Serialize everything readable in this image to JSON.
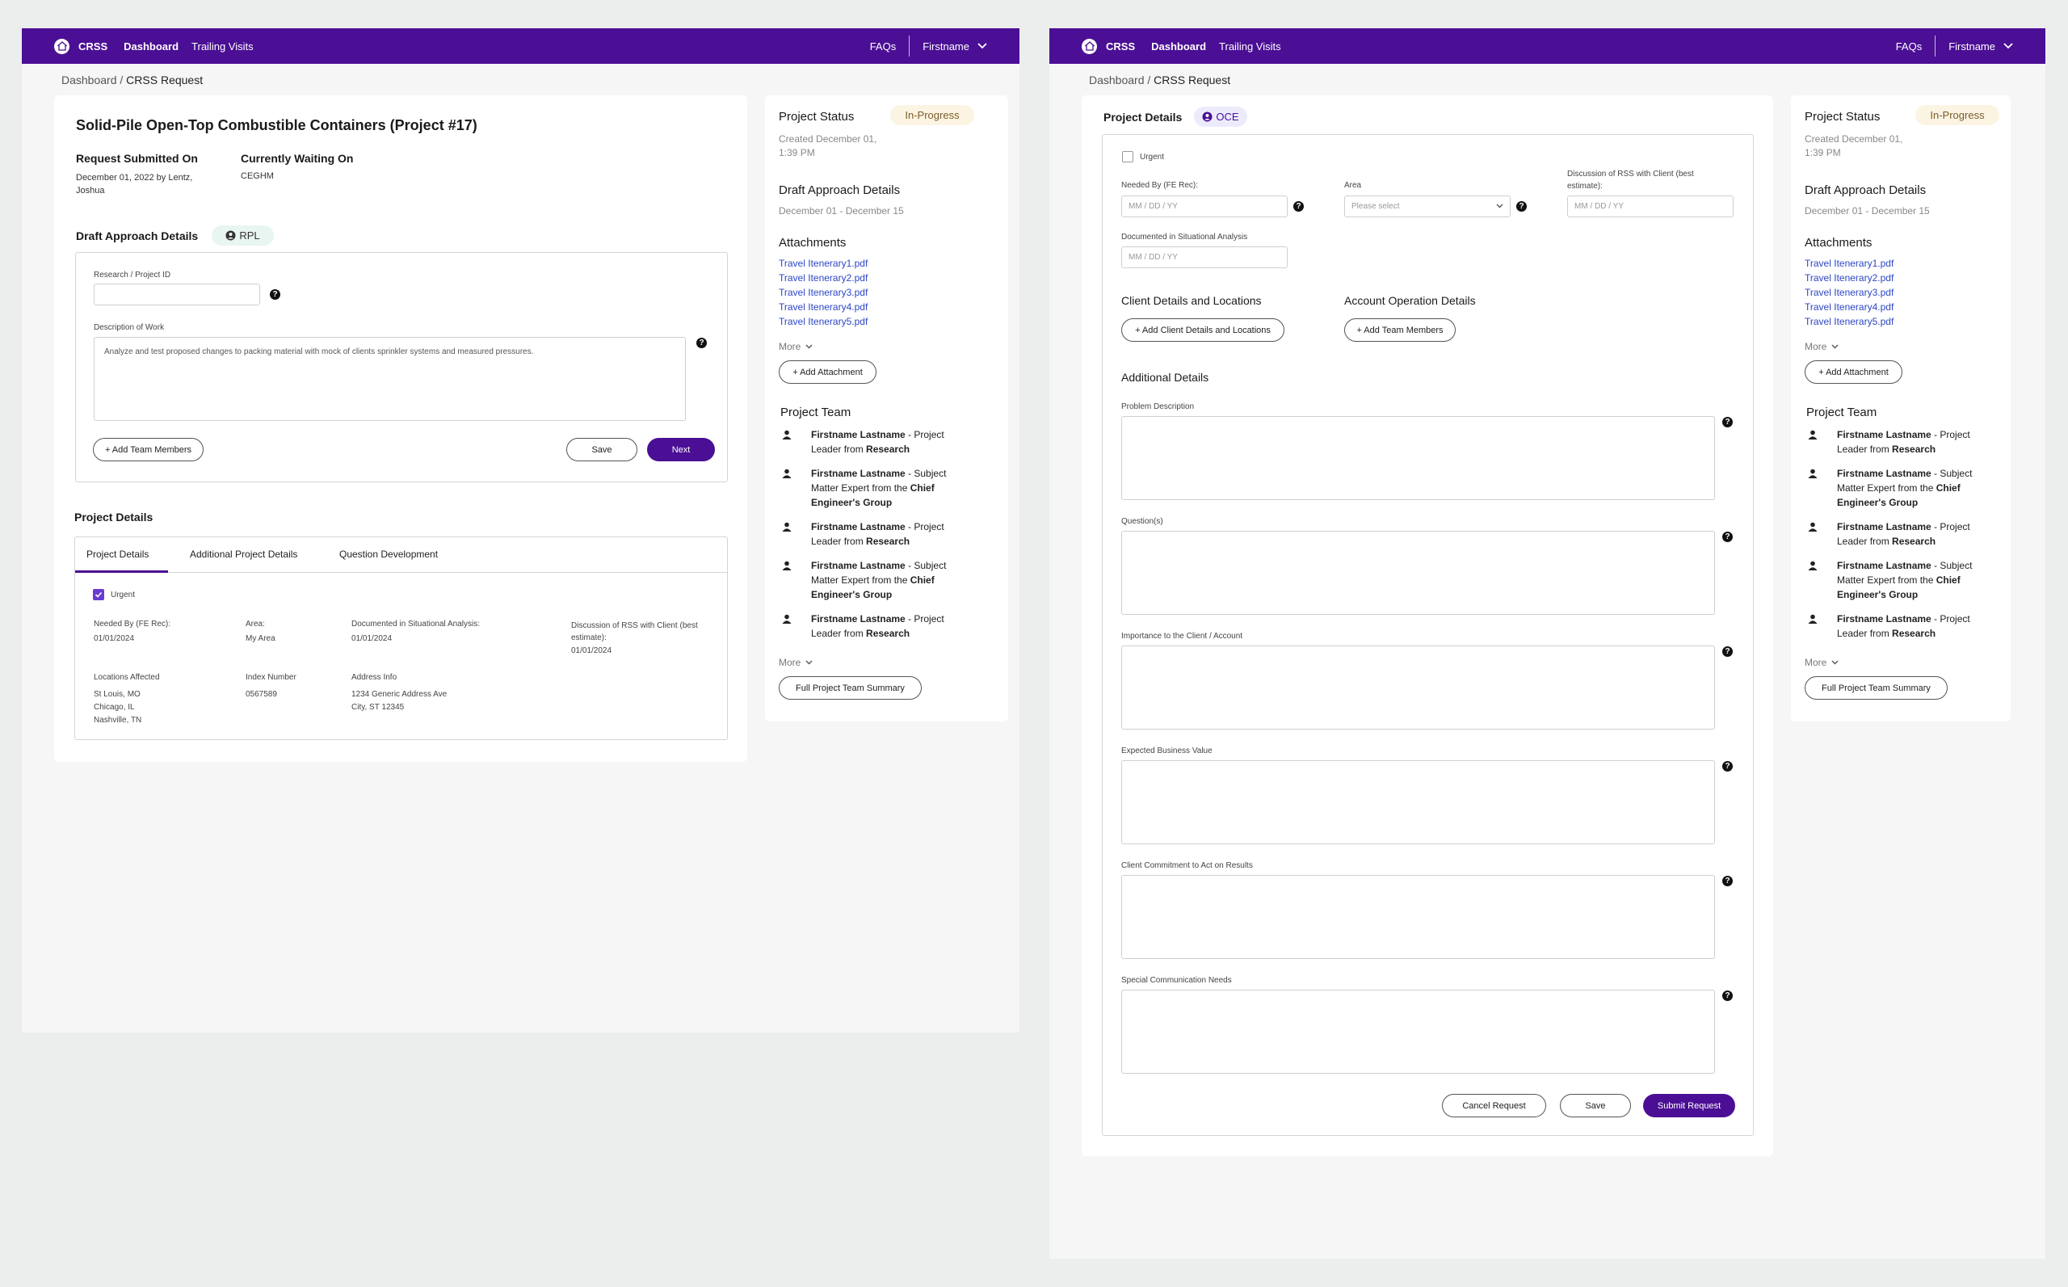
{
  "colors": {
    "topbar": "#4b0f95",
    "primary": "#4b0f95",
    "link": "#2d46c4",
    "status_pill": "#fcf4e3"
  },
  "nav": {
    "brand": "CRSS",
    "dashboard": "Dashboard",
    "trailing_visits": "Trailing Visits",
    "faqs": "FAQs",
    "user": "Firstname"
  },
  "breadcrumb": {
    "root": "Dashboard",
    "sep": " / ",
    "current": "CRSS Request"
  },
  "left": {
    "project_title": "Solid-Pile Open-Top Combustible Containers (Project #17)",
    "submitted_label": "Request Submitted On",
    "submitted_value": "December 01, 2022 by Lentz, Joshua",
    "waiting_label": "Currently Waiting On",
    "waiting_value": "CEGHM",
    "draft_heading": "Draft Approach Details",
    "draft_badge": "RPL",
    "research_id_label": "Research / Project ID",
    "research_id_value": "",
    "description_label": "Description of Work",
    "description_value": "Analyze and test proposed changes to packing material with mock of clients sprinkler systems and measured pressures.",
    "add_team_btn": "+ Add Team Members",
    "save_btn": "Save",
    "next_btn": "Next",
    "project_details_heading": "Project Details",
    "tabs": [
      "Project Details",
      "Additional Project Details",
      "Question Development"
    ],
    "urgent_label": "Urgent",
    "urgent_checked": true,
    "fields": [
      {
        "label": "Needed By (FE Rec):",
        "value": "01/01/2024"
      },
      {
        "label": "Area:",
        "value": "My Area"
      },
      {
        "label": "Documented in Situational Analysis:",
        "value": "01/01/2024"
      },
      {
        "label": "Discussion of RSS with Client (best estimate):",
        "value": "01/01/2024"
      }
    ],
    "locations_label": "Locations Affected",
    "locations": [
      "St Louis, MO",
      "Chicago, IL",
      "Nashville, TN"
    ],
    "index_label": "Index Number",
    "index_value": "0567589",
    "address_label": "Address Info",
    "address_lines": [
      "1234 Generic Address Ave",
      "City, ST 12345"
    ]
  },
  "sidebar": {
    "status_heading": "Project Status",
    "status_badge": "In-Progress",
    "created": "Created December 01, 1:39 PM",
    "draft_heading": "Draft Approach Details",
    "draft_dates": "December 01 - December 15",
    "attachments_heading": "Attachments",
    "attachments": [
      "Travel Itenerary1.pdf",
      "Travel Itenerary2.pdf",
      "Travel Itenerary3.pdf",
      "Travel Itenerary4.pdf",
      "Travel Itenerary5.pdf"
    ],
    "more": "More",
    "add_attachment": "+ Add Attachment",
    "team_heading": "Project Team",
    "team": [
      {
        "name": "Firstname Lastname",
        "role": " - Project Leader from ",
        "group": "Research"
      },
      {
        "name": "Firstname Lastname",
        "role": " - Subject Matter Expert from the ",
        "group": "Chief Engineer's Group"
      },
      {
        "name": "Firstname Lastname",
        "role": " - Project Leader from ",
        "group": "Research"
      },
      {
        "name": "Firstname Lastname",
        "role": " - Subject Matter Expert from the ",
        "group": "Chief Engineer's Group"
      },
      {
        "name": "Firstname Lastname",
        "role": " - Project Leader from ",
        "group": "Research"
      }
    ],
    "team_summary_btn": "Full Project Team Summary"
  },
  "right": {
    "heading": "Project Details",
    "badge": "OCE",
    "urgent_label": "Urgent",
    "needed_label": "Needed By (FE Rec):",
    "date_placeholder": "MM / DD / YY",
    "area_label": "Area",
    "area_placeholder": "Please select",
    "discussion_label": "Discussion of RSS with Client (best estimate):",
    "documented_label": "Documented in Situational Analysis",
    "client_heading": "Client Details and Locations",
    "client_btn": "+ Add Client Details and Locations",
    "account_heading": "Account Operation Details",
    "account_btn": "+ Add Team Members",
    "additional_heading": "Additional Details",
    "textareas": [
      "Problem Description",
      "Question(s)",
      "Importance to the Client / Account",
      "Expected Business Value",
      "Client Commitment to Act on Results",
      "Special Communication Needs"
    ],
    "cancel_btn": "Cancel Request",
    "save_btn": "Save",
    "submit_btn": "Submit Request"
  }
}
